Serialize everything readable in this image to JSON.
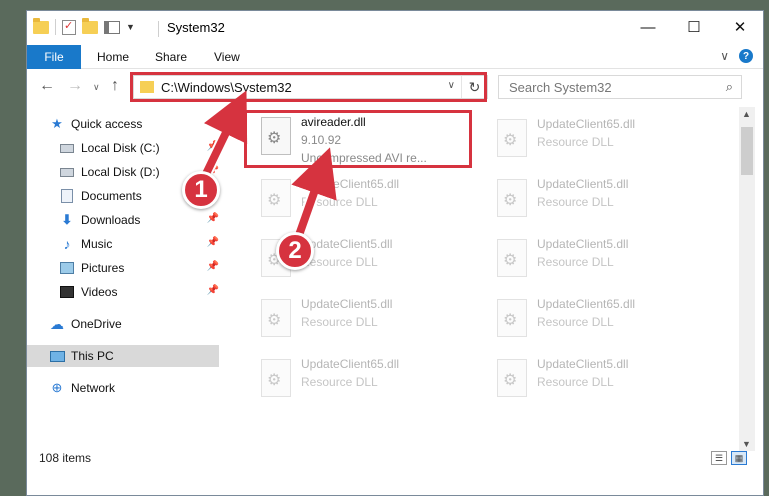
{
  "window": {
    "title": "System32",
    "controls": {
      "minimize": "—",
      "maximize": "☐",
      "close": "✕"
    }
  },
  "ribbon": {
    "tabs": [
      "File",
      "Home",
      "Share",
      "View"
    ],
    "collapse_glyph": "∨",
    "help_glyph": "?"
  },
  "navigation": {
    "back": "←",
    "forward": "→",
    "recent": "∨",
    "up": "↑",
    "address": "C:\\Windows\\System32",
    "address_dropdown": "∨",
    "refresh": "↻",
    "search_placeholder": "Search System32",
    "search_glyph": "⌕"
  },
  "sidebar": {
    "quick_access": "Quick access",
    "items": [
      {
        "label": "Local Disk (C:)",
        "pinned": true
      },
      {
        "label": "Local Disk (D:)",
        "pinned": true
      },
      {
        "label": "Documents",
        "pinned": true
      },
      {
        "label": "Downloads",
        "pinned": true
      },
      {
        "label": "Music",
        "pinned": true
      },
      {
        "label": "Pictures",
        "pinned": true
      },
      {
        "label": "Videos",
        "pinned": true
      }
    ],
    "onedrive": "OneDrive",
    "this_pc": "This PC",
    "network": "Network"
  },
  "files": {
    "highlighted": {
      "name": "avireader.dll",
      "version": "9.10.92",
      "description": "Uncompressed AVI re..."
    },
    "col1": [
      {
        "name": "UpdateClient65.dll",
        "type": "Resource DLL"
      },
      {
        "name": "UpdateClient5.dll",
        "type": "Resource DLL"
      },
      {
        "name": "UpdateClient5.dll",
        "type": "Resource DLL"
      },
      {
        "name": "UpdateClient65.dll",
        "type": "Resource DLL"
      }
    ],
    "col2": [
      {
        "name": "UpdateClient65.dll",
        "type": "Resource DLL"
      },
      {
        "name": "UpdateClient5.dll",
        "type": "Resource DLL"
      },
      {
        "name": "UpdateClient5.dll",
        "type": "Resource DLL"
      },
      {
        "name": "UpdateClient65.dll",
        "type": "Resource DLL"
      },
      {
        "name": "UpdateClient5.dll",
        "type": "Resource DLL"
      }
    ]
  },
  "status": {
    "count": "108 items"
  },
  "callouts": {
    "one": "1",
    "two": "2"
  },
  "colors": {
    "accent": "#1979ca",
    "callout_red": "#d6333f"
  }
}
